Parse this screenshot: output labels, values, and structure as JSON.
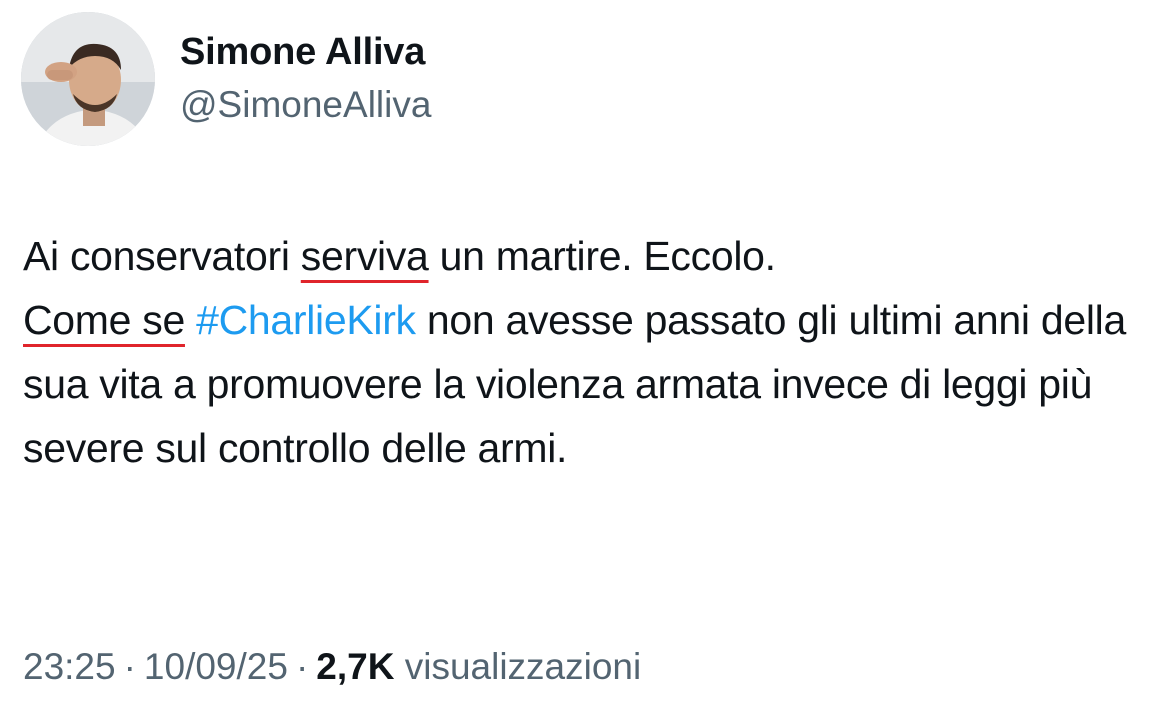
{
  "author": {
    "display_name": "Simone Alliva",
    "handle": "@SimoneAlliva"
  },
  "tweet": {
    "line1_a": "Ai conservatori ",
    "line1_underlined": "serviva",
    "line1_b": " un martire. Eccolo.",
    "line2_underlined": "Come se",
    "line2_space": " ",
    "hashtag": "#CharlieKirk",
    "line2_rest": " non avesse passato gli ultimi anni della sua vita a promuovere la violenza armata invece di leggi più severe sul controllo delle armi."
  },
  "meta": {
    "time": "23:25",
    "separator": "·",
    "date": "10/09/25",
    "views_count": "2,7K",
    "views_label": "visualizzazioni"
  },
  "colors": {
    "hashtag": "#1d9bf0",
    "underline": "#e0242b",
    "secondary_text": "#536471",
    "primary_text": "#0f1419"
  },
  "icons": {
    "avatar": "profile-photo"
  }
}
